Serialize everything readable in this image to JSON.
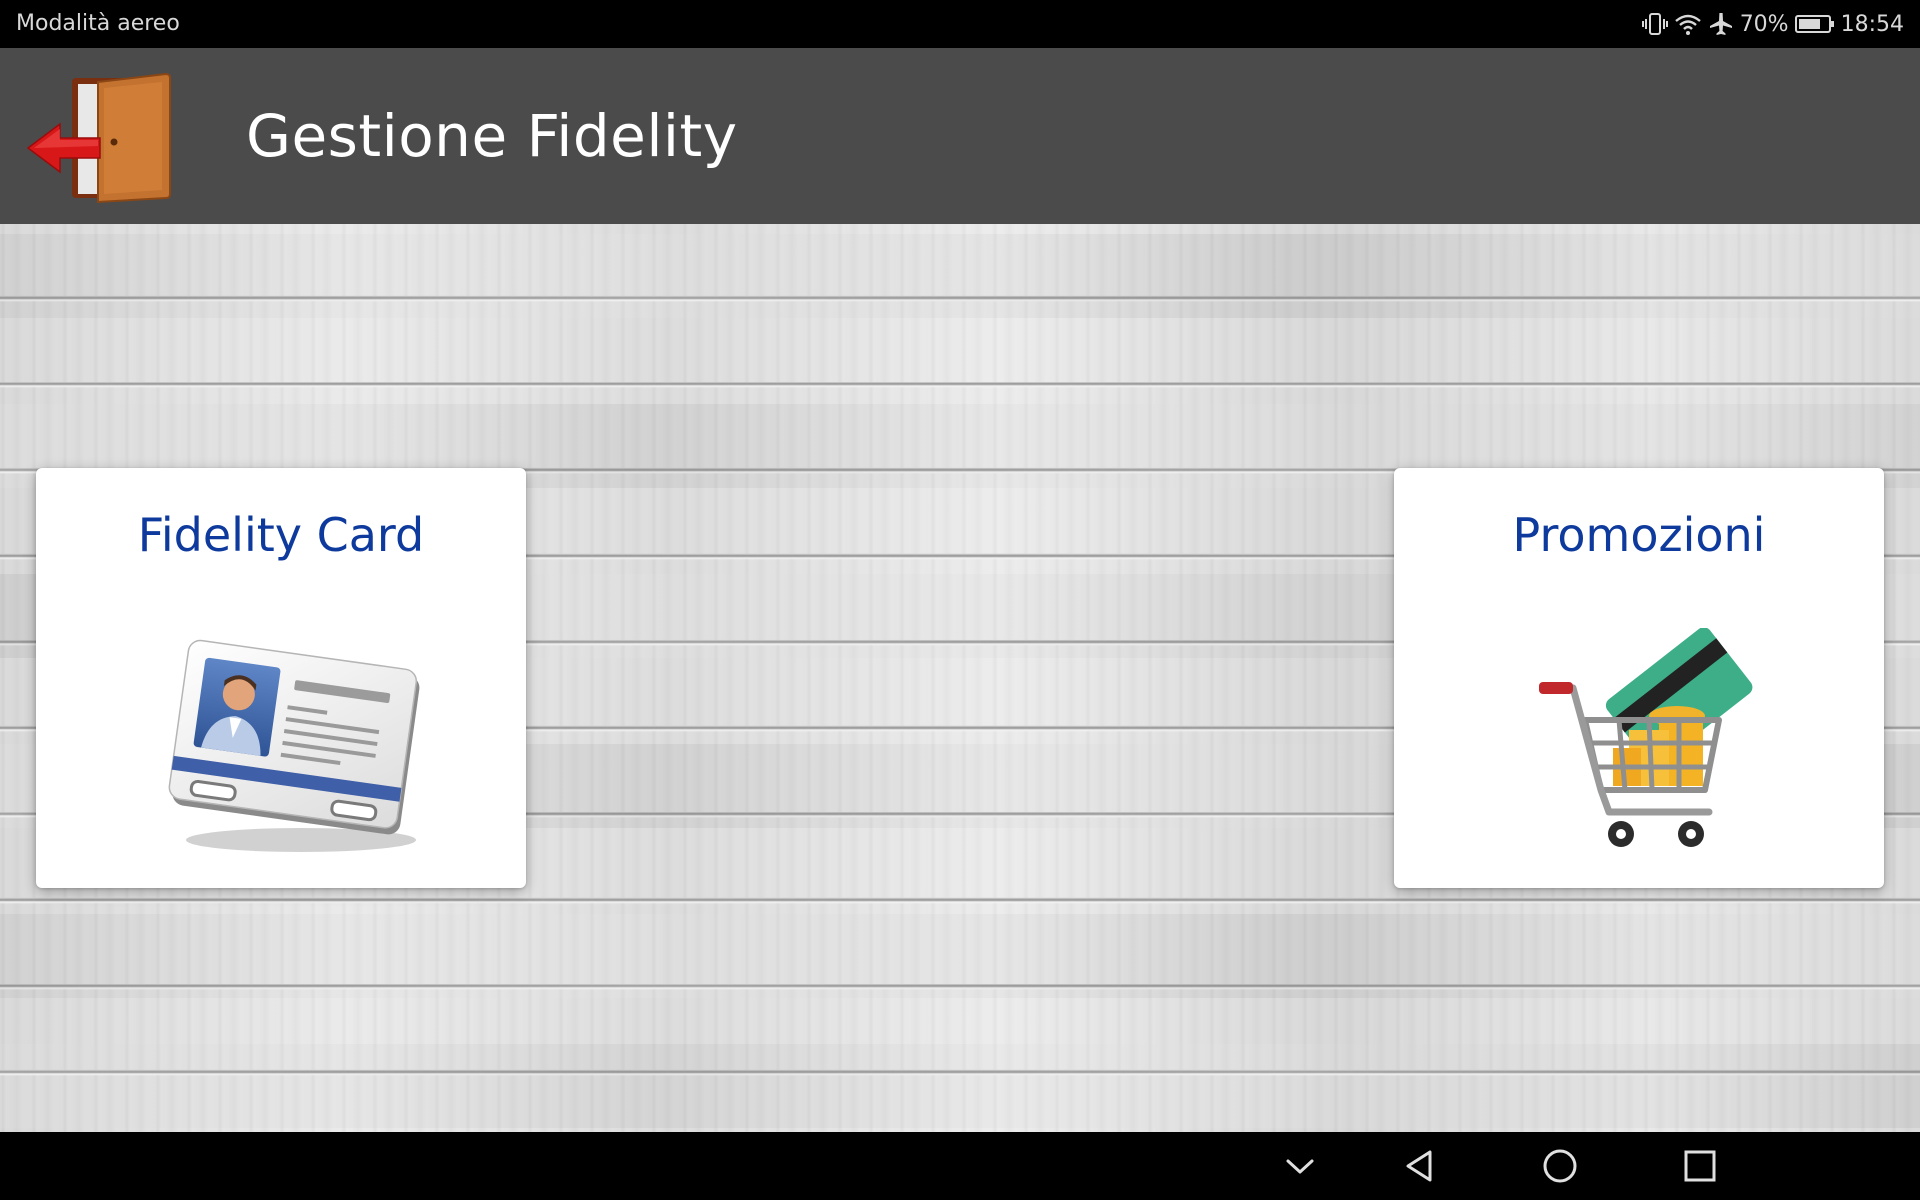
{
  "status_bar": {
    "left_text": "Modalità aereo",
    "battery_percent": "70%",
    "time": "18:54",
    "icons": [
      "vibrate-icon",
      "wifi-icon",
      "airplane-mode-icon",
      "battery-icon"
    ]
  },
  "app_bar": {
    "title": "Gestione Fidelity",
    "exit_icon": "exit-door-icon"
  },
  "tiles": [
    {
      "label": "Fidelity Card",
      "icon": "id-card-icon"
    },
    {
      "label": "Promozioni",
      "icon": "shopping-cart-icon"
    }
  ],
  "nav_bar": {
    "icons": [
      "hide-keyboard-icon",
      "back-icon",
      "home-icon",
      "recents-icon"
    ]
  },
  "colors": {
    "status_bar_bg": "#000000",
    "app_bar_bg": "#4b4b4b",
    "tile_label": "#0d3a9c",
    "tile_bg": "#ffffff"
  }
}
